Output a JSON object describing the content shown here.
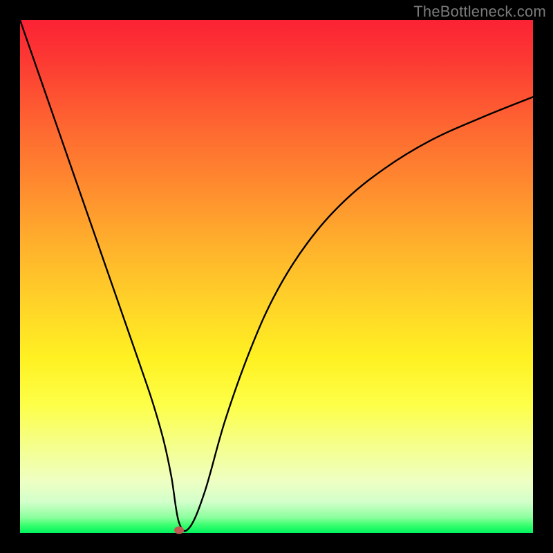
{
  "watermark": "TheBottleneck.com",
  "chart_data": {
    "type": "line",
    "title": "",
    "xlabel": "",
    "ylabel": "",
    "xlim": [
      0,
      100
    ],
    "ylim": [
      0,
      100
    ],
    "grid": false,
    "legend": false,
    "series": [
      {
        "name": "bottleneck-curve",
        "x": [
          0,
          4,
          8,
          12,
          16,
          20,
          24,
          26,
          28,
          29.5,
          31,
          33,
          36,
          40,
          45,
          50,
          56,
          63,
          71,
          80,
          90,
          100
        ],
        "y": [
          100,
          88.5,
          77,
          65.5,
          54,
          42.5,
          31,
          25,
          18,
          11,
          2,
          1,
          8,
          22,
          36,
          47,
          56.5,
          64.5,
          71,
          76.5,
          81,
          85
        ]
      }
    ],
    "marker": {
      "x": 31,
      "y": 0.5,
      "color": "#c25a53"
    },
    "background_gradient": {
      "stops": [
        {
          "pos": 0,
          "color": "#fb2234"
        },
        {
          "pos": 50,
          "color": "#ffd528"
        },
        {
          "pos": 100,
          "color": "#00f45e"
        }
      ]
    }
  }
}
